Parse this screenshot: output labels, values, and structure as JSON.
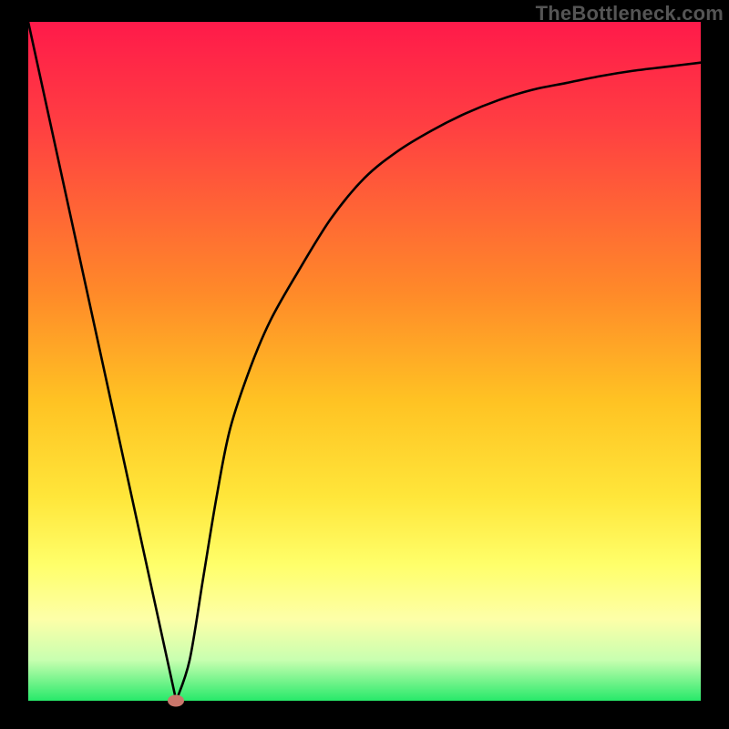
{
  "watermark": "TheBottleneck.com",
  "colors": {
    "page_bg": "#000000",
    "curve_stroke": "#000000",
    "min_marker": "#c9766b",
    "gradient_stops": [
      "#ff1a4a",
      "#ff3e42",
      "#ff8a29",
      "#ffc323",
      "#ffe63a",
      "#ffff6a",
      "#fdffa8",
      "#c8ffb0",
      "#27e96a"
    ]
  },
  "chart_data": {
    "type": "line",
    "title": "",
    "xlabel": "",
    "ylabel": "",
    "xlim": [
      0,
      100
    ],
    "ylim": [
      0,
      100
    ],
    "grid": false,
    "x": [
      0,
      5,
      10,
      15,
      20,
      22,
      24,
      26,
      28,
      30,
      33,
      36,
      40,
      45,
      50,
      55,
      60,
      65,
      70,
      75,
      80,
      85,
      90,
      95,
      100
    ],
    "series": [
      {
        "name": "bottleneck-curve",
        "values": [
          100,
          78,
          56,
          33,
          11,
          0,
          6,
          18,
          30,
          40,
          49,
          56,
          63,
          71,
          77,
          81,
          84,
          86.5,
          88.5,
          90,
          91,
          92,
          92.8,
          93.4,
          94
        ]
      }
    ],
    "annotations": [
      {
        "name": "minimum-marker",
        "x": 22,
        "y": 0
      }
    ]
  }
}
